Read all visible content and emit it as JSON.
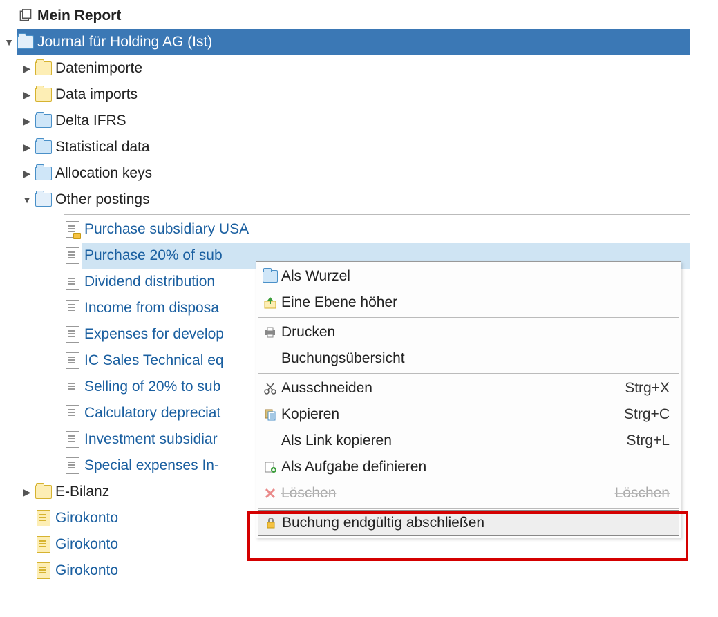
{
  "header": {
    "title": "Mein Report"
  },
  "tree": {
    "root": {
      "label": "Journal für Holding AG (Ist)"
    },
    "folders": [
      {
        "label": "Datenimporte"
      },
      {
        "label": "Data imports"
      },
      {
        "label": "Delta IFRS"
      },
      {
        "label": "Statistical data"
      },
      {
        "label": "Allocation keys"
      },
      {
        "label": "Other postings"
      },
      {
        "label": "E-Bilanz"
      }
    ],
    "postings": [
      {
        "label": "Purchase subsidiary USA"
      },
      {
        "label": "Purchase 20% of sub"
      },
      {
        "label": "Dividend distribution"
      },
      {
        "label": "Income from disposa"
      },
      {
        "label": "Expenses for develop"
      },
      {
        "label": "IC Sales Technical eq"
      },
      {
        "label": "Selling of 20% to sub"
      },
      {
        "label": "Calculatory depreciat"
      },
      {
        "label": "Investment subsidiar"
      },
      {
        "label": "Special expenses In-"
      }
    ],
    "accounts": [
      {
        "label": "Girokonto"
      },
      {
        "label": "Girokonto"
      },
      {
        "label": "Girokonto"
      }
    ]
  },
  "contextMenu": {
    "items": [
      {
        "label": "Als Wurzel",
        "shortcut": "",
        "icon": "folder-blue"
      },
      {
        "label": "Eine Ebene höher",
        "shortcut": "",
        "icon": "up-arrow"
      },
      {
        "label": "Drucken",
        "shortcut": "",
        "icon": "printer"
      },
      {
        "label": "Buchungsübersicht",
        "shortcut": "",
        "icon": "none"
      },
      {
        "label": "Ausschneiden",
        "shortcut": "Strg+X",
        "icon": "scissors"
      },
      {
        "label": "Kopieren",
        "shortcut": "Strg+C",
        "icon": "copy"
      },
      {
        "label": "Als Link kopieren",
        "shortcut": "Strg+L",
        "icon": "none"
      },
      {
        "label": "Als Aufgabe definieren",
        "shortcut": "",
        "icon": "task"
      },
      {
        "label": "Löschen",
        "shortcut": "Löschen",
        "icon": "delete"
      },
      {
        "label": "Buchung endgültig abschließen",
        "shortcut": "",
        "icon": "lock"
      }
    ]
  },
  "colors": {
    "selectionDark": "#3b78b5",
    "selectionLight": "#cfe4f3",
    "link": "#1a5fa0",
    "highlight": "#d40000"
  }
}
